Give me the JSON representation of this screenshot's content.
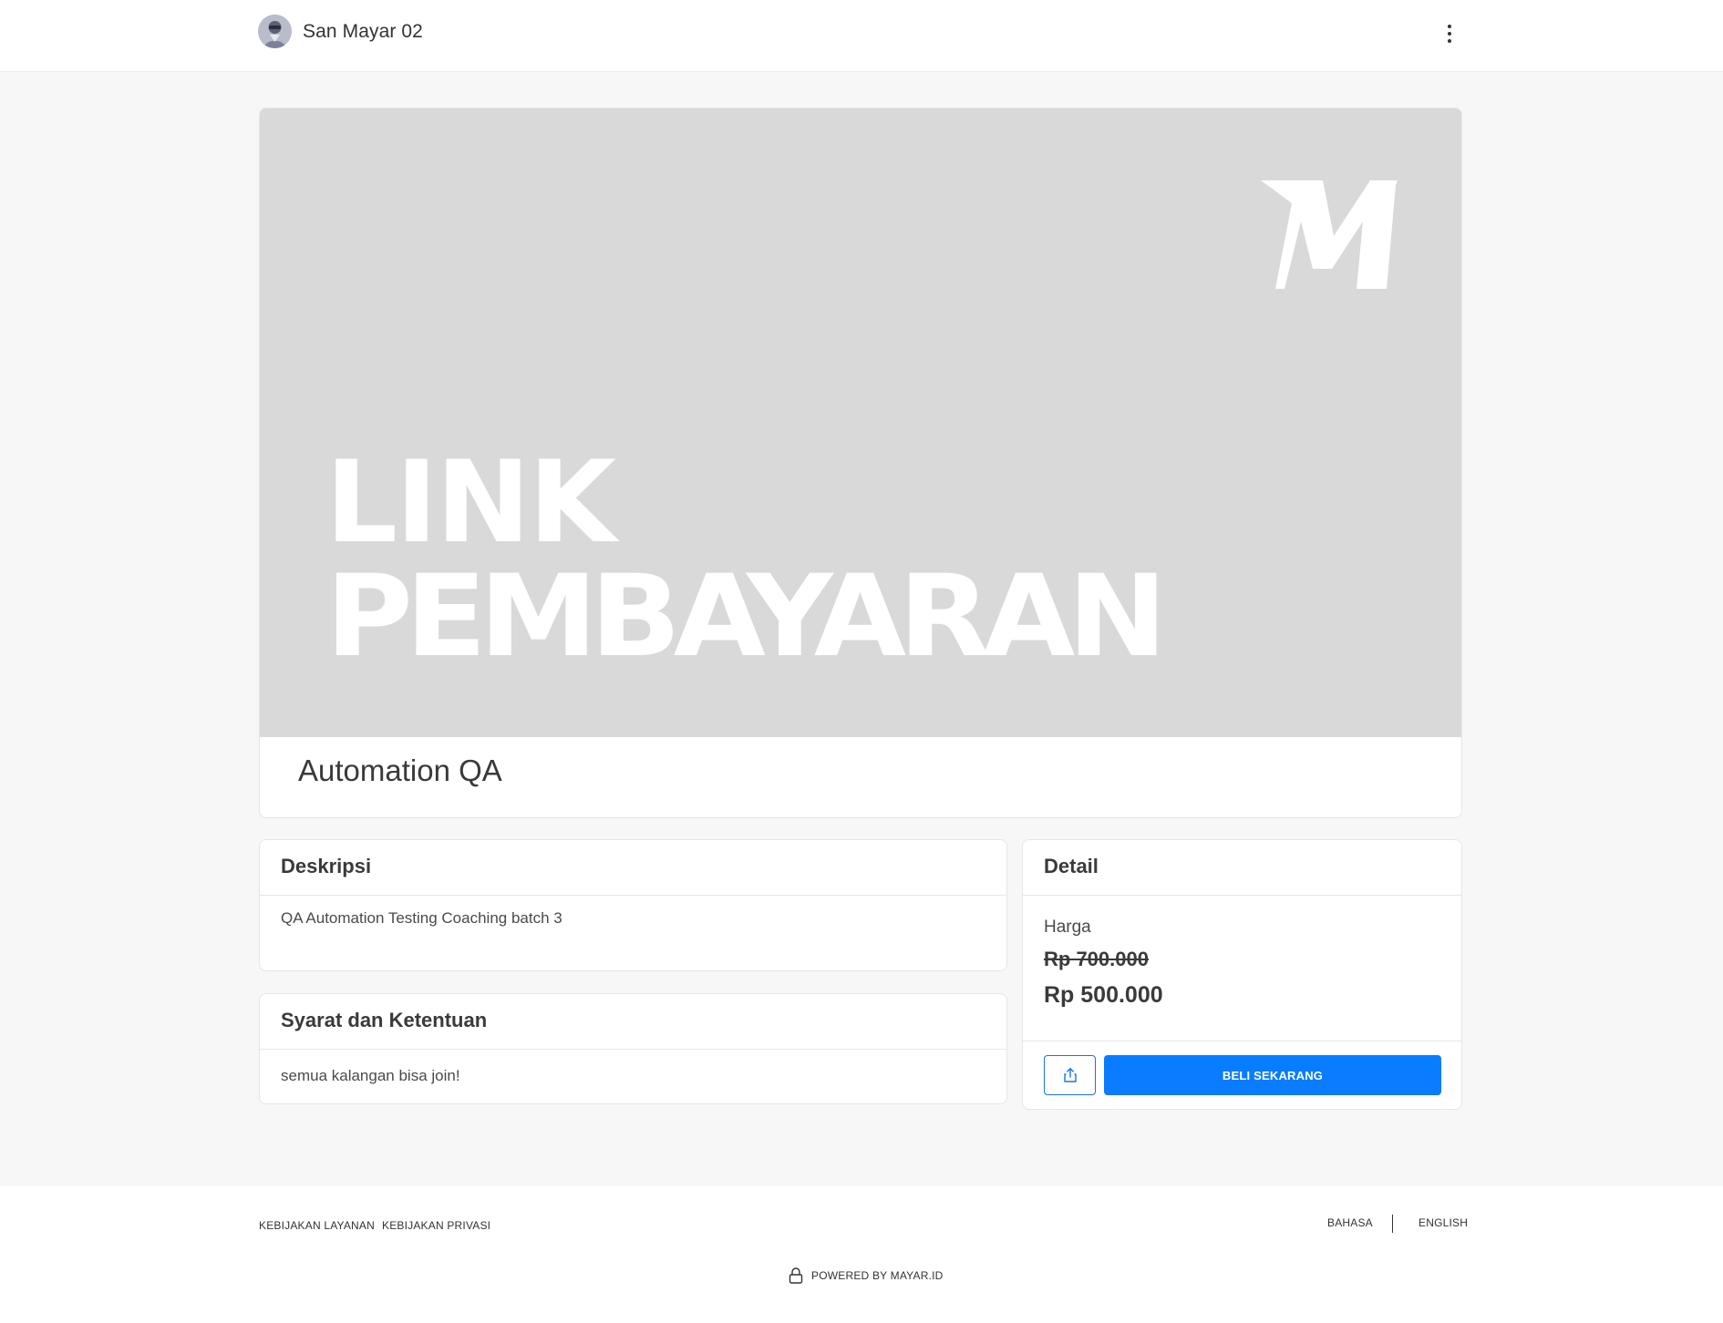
{
  "header": {
    "store_name": "San Mayar 02",
    "avatar_icon": "user-avatar-icon",
    "menu_icon": "kebab-menu-icon"
  },
  "banner": {
    "logo_text": "M",
    "line1": "LINK",
    "line2": "PEMBAYARAN"
  },
  "product": {
    "title": "Automation QA"
  },
  "description": {
    "heading": "Deskripsi",
    "text": "QA Automation Testing Coaching batch 3"
  },
  "terms": {
    "heading": "Syarat dan Ketentuan",
    "text": "semua kalangan bisa join!"
  },
  "detail": {
    "heading": "Detail",
    "price_label": "Harga",
    "price_old": "Rp 700.000",
    "price_new": "Rp 500.000",
    "share_icon": "share-upload-icon",
    "buy_label": "BELI SEKARANG"
  },
  "footer": {
    "terms_link": "KEBIJAKAN LAYANAN",
    "privacy_link": "KEBIJAKAN PRIVASI",
    "lang_bahasa": "BAHASA",
    "lang_english": "ENGLISH",
    "powered_by": "POWERED BY MAYAR.ID",
    "lock_icon": "lock-icon"
  },
  "colors": {
    "primary": "#0a7cff",
    "banner_bg": "#d9d9d9",
    "page_bg": "#f7f7f7"
  }
}
